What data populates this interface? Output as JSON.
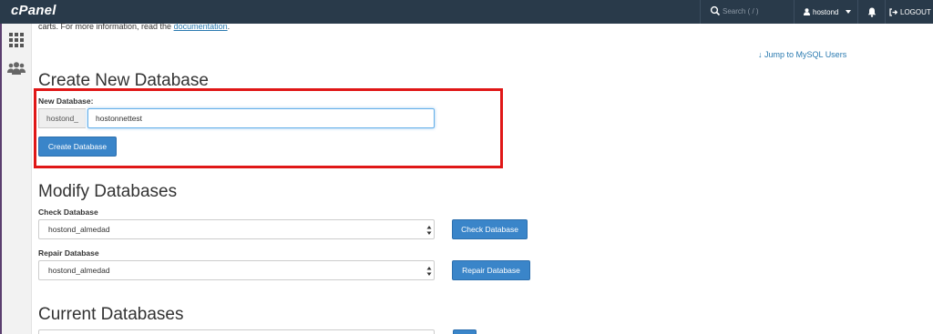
{
  "header": {
    "logo": "cPanel",
    "search_placeholder": "Search ( / )",
    "username": "hostond",
    "logout_label": "LOGOUT"
  },
  "intro": {
    "text_before": "carts. For more information, read the ",
    "link": "documentation",
    "text_after": "."
  },
  "jump_link": "↓ Jump to MySQL Users",
  "create": {
    "heading": "Create New Database",
    "label": "New Database:",
    "prefix": "hostond_",
    "input_value": "hostonnettest",
    "button": "Create Database"
  },
  "modify": {
    "heading": "Modify Databases",
    "check_label": "Check Database",
    "check_selected": "hostond_almedad",
    "check_button": "Check Database",
    "repair_label": "Repair Database",
    "repair_selected": "hostond_almedad",
    "repair_button": "Repair Database"
  },
  "current": {
    "heading": "Current Databases"
  },
  "colors": {
    "topbar": "#293a4a",
    "primary_button": "#3a85c9",
    "link": "#2a7ab0",
    "highlight": "#e01717"
  },
  "icons": [
    "search-icon",
    "user-icon",
    "bell-icon",
    "logout-icon",
    "apps-grid-icon",
    "users-icon"
  ]
}
